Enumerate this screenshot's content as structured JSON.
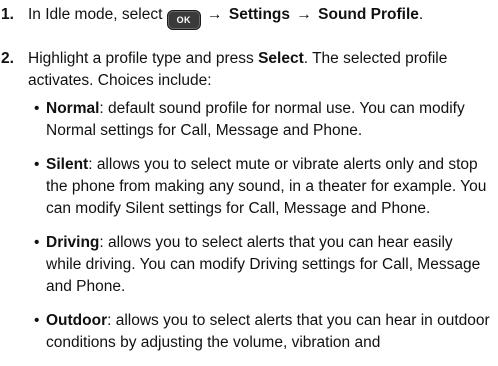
{
  "steps": [
    {
      "number": "1.",
      "prefix": "In Idle mode, select",
      "key_label": "OK",
      "arrow1": "→",
      "settings": "Settings",
      "arrow2": "→",
      "sound_profile": "Sound Profile",
      "end": "."
    },
    {
      "number": "2.",
      "text_a": "Highlight a profile type and press ",
      "select_word": "Select",
      "text_b": ". The selected profile activates. Choices include:"
    }
  ],
  "profiles": [
    {
      "name": "Normal",
      "description": ": default sound profile for normal use. You can modify Normal settings for Call, Message and Phone."
    },
    {
      "name": "Silent",
      "description": ": allows you to select mute or vibrate alerts only and stop the phone from making any sound, in a theater for example. You can modify Silent settings for Call, Message and Phone."
    },
    {
      "name": "Driving",
      "description": ": allows you to select alerts that you can hear easily while driving. You can modify Driving settings for Call, Message and Phone."
    },
    {
      "name": "Outdoor",
      "description": ": allows you to select alerts that you can hear in outdoor conditions by adjusting the volume, vibration and"
    }
  ],
  "bullet_glyph": "•"
}
